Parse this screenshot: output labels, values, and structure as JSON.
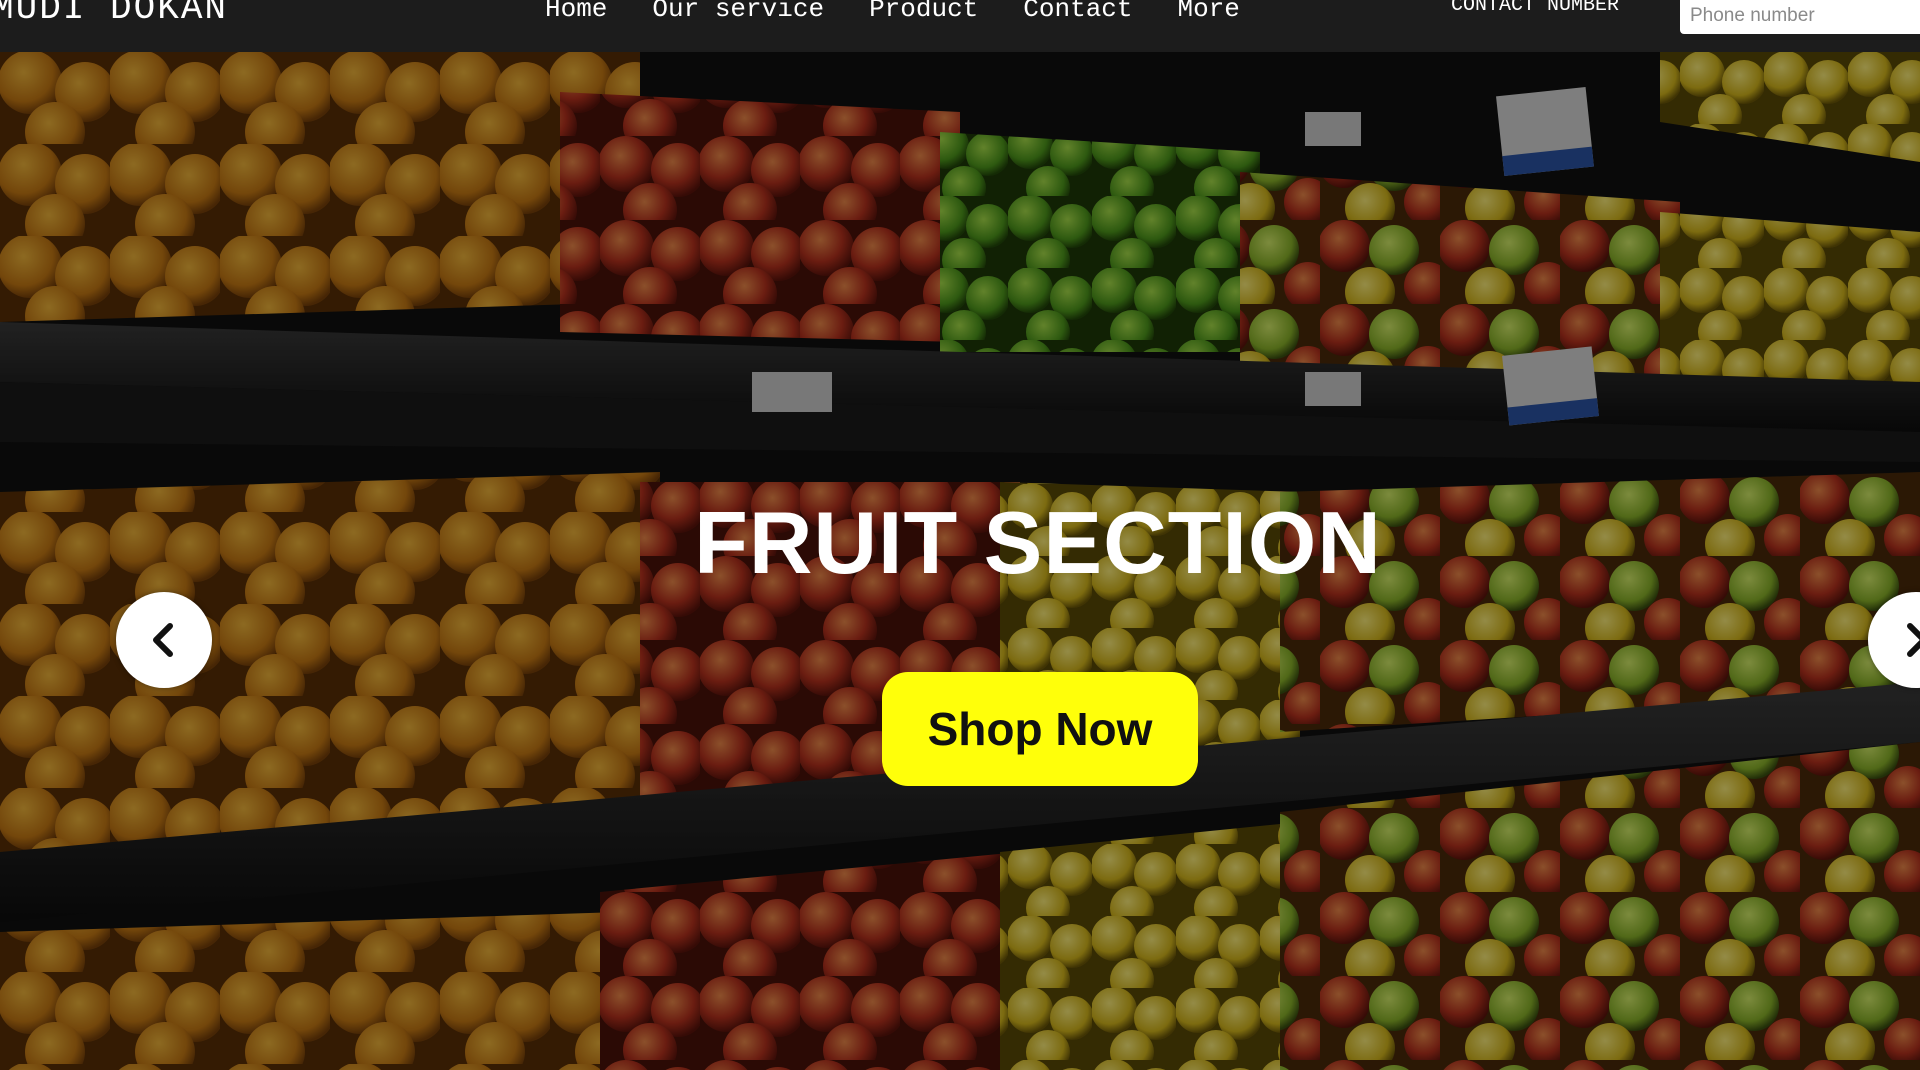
{
  "navbar": {
    "brand": "MUDI DOKAN",
    "links": [
      "Home",
      "Our service",
      "Product",
      "Contact",
      "More"
    ],
    "contact_label": "CONTACT NUMBER",
    "phone_placeholder": "Phone number",
    "phone_value": ""
  },
  "hero": {
    "title": "FRUIT SECTION",
    "cta_label": "Shop Now",
    "background": "fruit-shelves-photo",
    "prev_icon": "chevron-left-icon",
    "next_icon": "chevron-right-icon"
  },
  "colors": {
    "navbar_bg": "#1c1c1c",
    "cta_bg": "#ffff0a",
    "cta_text": "#111111",
    "title_text": "#ffffff"
  }
}
